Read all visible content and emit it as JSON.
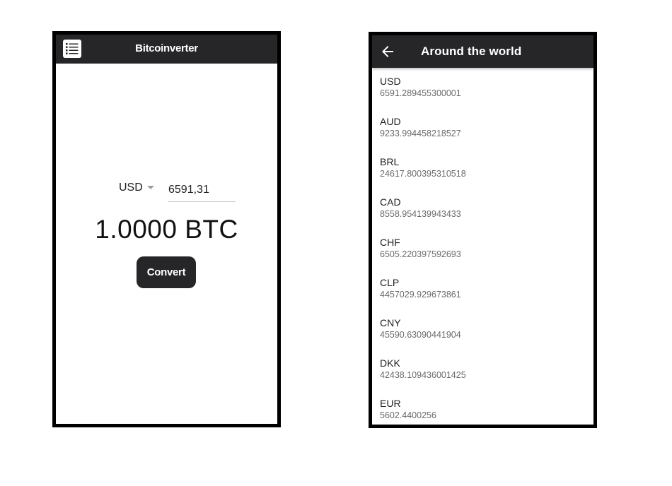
{
  "converter": {
    "title": "Bitcoinverter",
    "currency": "USD",
    "amount": "6591,31",
    "result": "1.0000 BTC",
    "convert_label": "Convert"
  },
  "world": {
    "title": "Around the world",
    "rates": [
      {
        "code": "USD",
        "value": "6591.289455300001"
      },
      {
        "code": "AUD",
        "value": "9233.994458218527"
      },
      {
        "code": "BRL",
        "value": "24617.800395310518"
      },
      {
        "code": "CAD",
        "value": "8558.954139943433"
      },
      {
        "code": "CHF",
        "value": "6505.220397592693"
      },
      {
        "code": "CLP",
        "value": "4457029.929673861"
      },
      {
        "code": "CNY",
        "value": "45590.63090441904"
      },
      {
        "code": "DKK",
        "value": "42438.109436001425"
      },
      {
        "code": "EUR",
        "value": "5602.4400256"
      }
    ]
  },
  "icons": {
    "menu": "list-menu-icon",
    "back": "arrow-back-icon",
    "dropdown": "caret-down-icon"
  },
  "colors": {
    "appbar": "#262629",
    "button": "#262629",
    "frame": "#000000"
  }
}
